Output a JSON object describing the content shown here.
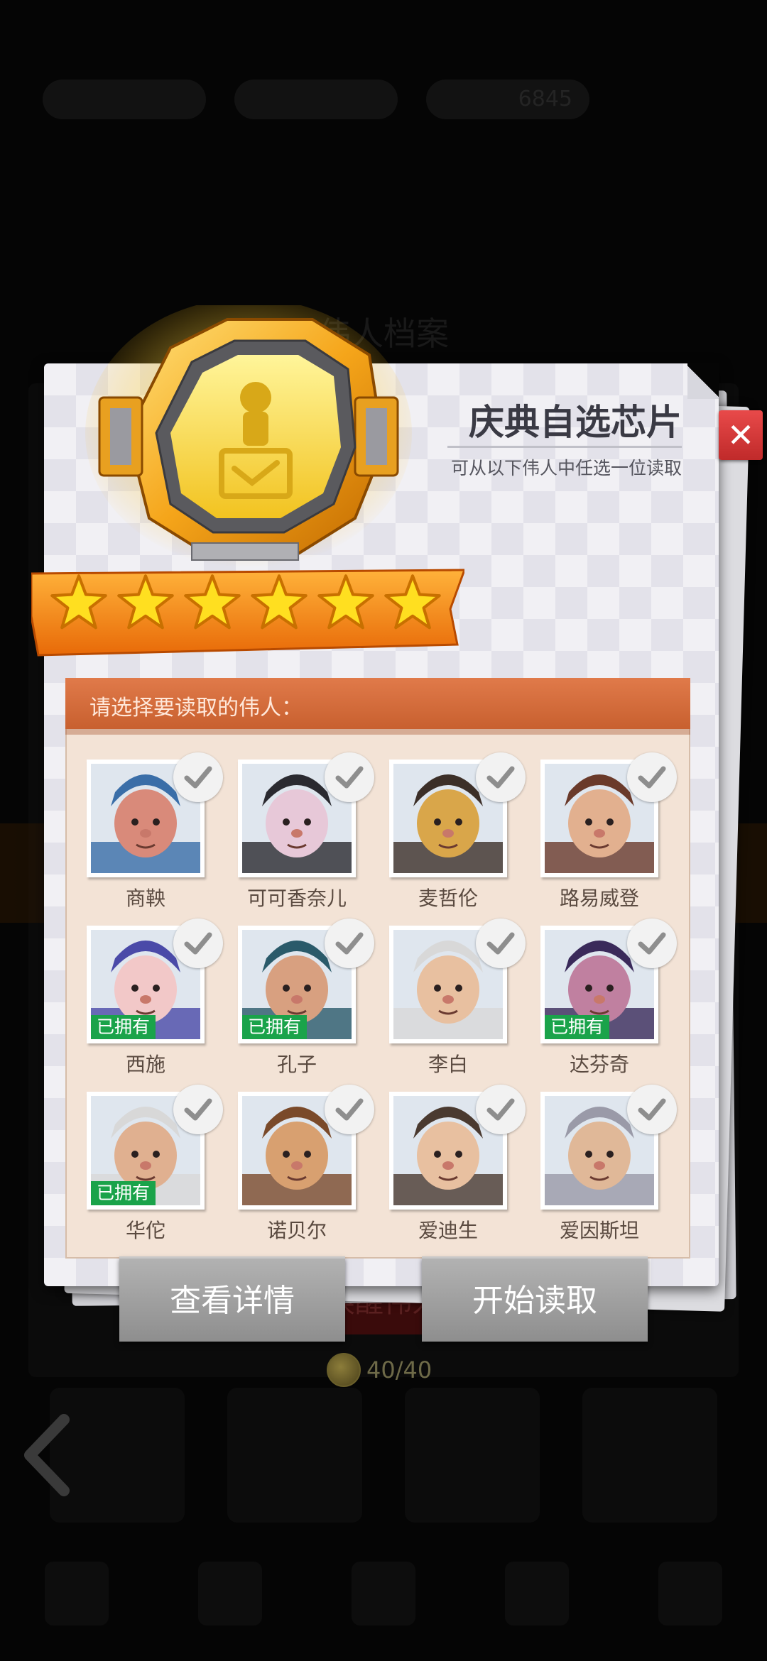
{
  "background": {
    "resources": [
      "",
      "",
      "6845"
    ],
    "panel_title": "伟人档案",
    "bottom_button": "唤醒伟人",
    "counter": "40/40"
  },
  "dialog": {
    "title": "庆典自选芯片",
    "subtitle": "可从以下伟人中任选一位读取",
    "star_count": 6,
    "prompt": "请选择要读取的伟人：",
    "owned_label": "已拥有",
    "heroes": [
      {
        "name": "商鞅",
        "owned": false,
        "colors": [
          "#3a6ea8",
          "#d98a7a"
        ]
      },
      {
        "name": "可可香奈儿",
        "owned": false,
        "colors": [
          "#2a2a30",
          "#e7c8d8"
        ]
      },
      {
        "name": "麦哲伦",
        "owned": false,
        "colors": [
          "#3c2f28",
          "#d9a64a"
        ]
      },
      {
        "name": "路易威登",
        "owned": false,
        "colors": [
          "#6a3a2a",
          "#e2b08f"
        ]
      },
      {
        "name": "西施",
        "owned": true,
        "colors": [
          "#4a4aa8",
          "#f2c8c8"
        ]
      },
      {
        "name": "孔子",
        "owned": true,
        "colors": [
          "#2a5a6a",
          "#d8a080"
        ]
      },
      {
        "name": "李白",
        "owned": false,
        "colors": [
          "#d8d8d8",
          "#e8c0a0"
        ]
      },
      {
        "name": "达芬奇",
        "owned": true,
        "colors": [
          "#3a2a5a",
          "#c080a0"
        ]
      },
      {
        "name": "华佗",
        "owned": true,
        "colors": [
          "#d8d8d8",
          "#e0b090"
        ]
      },
      {
        "name": "诺贝尔",
        "owned": false,
        "colors": [
          "#7a4a2a",
          "#d8a070"
        ]
      },
      {
        "name": "爱迪生",
        "owned": false,
        "colors": [
          "#4a3a30",
          "#e8c0a0"
        ]
      },
      {
        "name": "爱因斯坦",
        "owned": false,
        "colors": [
          "#9a9aa8",
          "#e0b898"
        ]
      }
    ],
    "buttons": {
      "details": "查看详情",
      "start": "开始读取"
    }
  },
  "icons": {
    "close": "close-icon",
    "check": "check-icon",
    "chip": "chip-emblem-icon",
    "star": "star-icon",
    "back": "back-arrow-icon",
    "coin": "coin-icon"
  }
}
